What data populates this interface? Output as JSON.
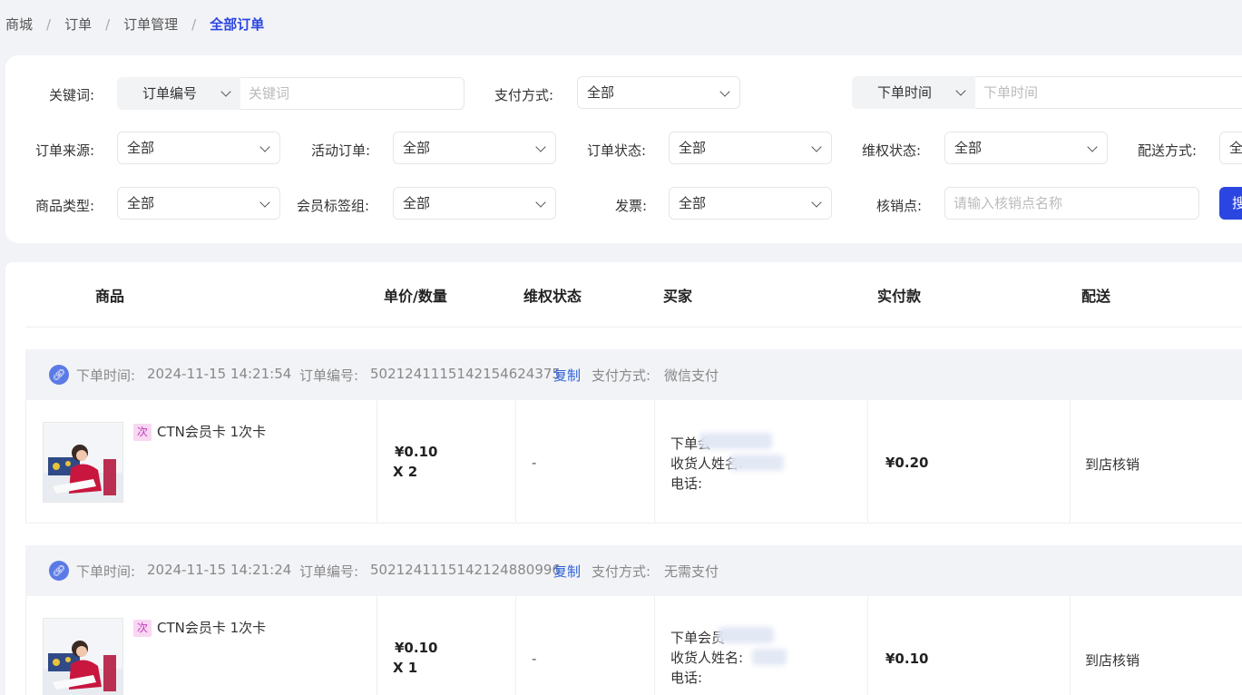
{
  "breadcrumb": {
    "items": [
      "商城",
      "订单",
      "订单管理"
    ],
    "current": "全部订单"
  },
  "filters": {
    "keyword": {
      "label": "关键词:",
      "type": "订单编号",
      "placeholder": "关键词"
    },
    "pay_method": {
      "label": "支付方式:",
      "value": "全部"
    },
    "order_time": {
      "type": "下单时间",
      "placeholder": "下单时间"
    },
    "order_source": {
      "label": "订单来源:",
      "value": "全部"
    },
    "activity_order": {
      "label": "活动订单:",
      "value": "全部"
    },
    "order_status": {
      "label": "订单状态:",
      "value": "全部"
    },
    "rights_status": {
      "label": "维权状态:",
      "value": "全部"
    },
    "delivery_method": {
      "label": "配送方式:",
      "value": "全"
    },
    "goods_type": {
      "label": "商品类型:",
      "value": "全部"
    },
    "member_tag": {
      "label": "会员标签组:",
      "value": "全部"
    },
    "invoice": {
      "label": "发票:",
      "value": "全部"
    },
    "verify_point": {
      "label": "核销点:",
      "placeholder": "请输入核销点名称"
    },
    "search_label": "搜"
  },
  "table": {
    "headers": [
      "商品",
      "单价/数量",
      "维权状态",
      "买家",
      "实付款",
      "配送"
    ]
  },
  "orders": [
    {
      "time_label": "下单时间:",
      "time": "2024-11-15 14:21:54",
      "no_label": "订单编号:",
      "no": "5021241115142154624375",
      "copy": "复制",
      "pay_label": "支付方式:",
      "pay": "微信支付",
      "badge": "次",
      "product": "CTN会员卡 1次卡",
      "price": "¥0.10",
      "qty": "X 2",
      "rights": "-",
      "buyer_line1": "下单会",
      "buyer_line2": "收货人姓名:",
      "buyer_line3": "电话:",
      "paid": "¥0.20",
      "delivery": "到店核销"
    },
    {
      "time_label": "下单时间:",
      "time": "2024-11-15 14:21:24",
      "no_label": "订单编号:",
      "no": "5021241115142124880996",
      "copy": "复制",
      "pay_label": "支付方式:",
      "pay": "无需支付",
      "badge": "次",
      "product": "CTN会员卡 1次卡",
      "price": "¥0.10",
      "qty": "X 1",
      "rights": "-",
      "buyer_line1": "下单会员",
      "buyer_line2": "收货人姓名:",
      "buyer_line3": "电话:",
      "paid": "¥0.10",
      "delivery": "到店核销"
    }
  ]
}
